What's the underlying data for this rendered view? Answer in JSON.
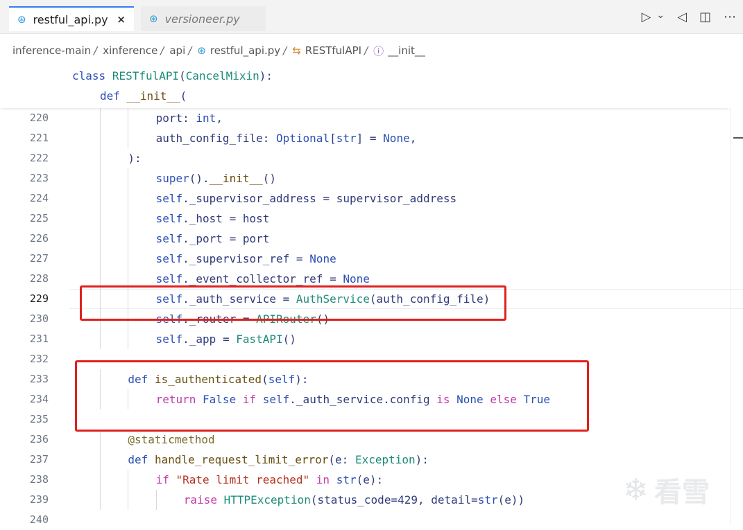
{
  "tabs": [
    {
      "label": "restful_api.py",
      "close": "×"
    },
    {
      "label": "versioneer.py"
    }
  ],
  "toolbar": {
    "run_icon": "play-icon",
    "run_glyph": "▷",
    "dropdown_glyph": "⌄",
    "broadcast_glyph": "◁",
    "split_glyph": "◫",
    "more_glyph": "⋯"
  },
  "breadcrumb": {
    "items": [
      "inference-main",
      "xinference",
      "api",
      "restful_api.py",
      "RESTfulAPI",
      "__init__"
    ],
    "separator": "/"
  },
  "sticky": {
    "line1": "class RESTfulAPI(CancelMixin):",
    "line2": "def __init__("
  },
  "lines": [
    {
      "num": "220",
      "text": "port: int,"
    },
    {
      "num": "221",
      "text": "auth_config_file: Optional[str] = None,"
    },
    {
      "num": "222",
      "text": "):"
    },
    {
      "num": "223",
      "text": "super().__init__()"
    },
    {
      "num": "224",
      "text": "self._supervisor_address = supervisor_address"
    },
    {
      "num": "225",
      "text": "self._host = host"
    },
    {
      "num": "226",
      "text": "self._port = port"
    },
    {
      "num": "227",
      "text": "self._supervisor_ref = None"
    },
    {
      "num": "228",
      "text": "self._event_collector_ref = None"
    },
    {
      "num": "229",
      "text": "self._auth_service = AuthService(auth_config_file)"
    },
    {
      "num": "230",
      "text": "self._router = APIRouter()"
    },
    {
      "num": "231",
      "text": "self._app = FastAPI()"
    },
    {
      "num": "232",
      "text": ""
    },
    {
      "num": "233",
      "text": "def is_authenticated(self):"
    },
    {
      "num": "234",
      "text": "return False if self._auth_service.config is None else True"
    },
    {
      "num": "235",
      "text": ""
    },
    {
      "num": "236",
      "text": "@staticmethod"
    },
    {
      "num": "237",
      "text": "def handle_request_limit_error(e: Exception):"
    },
    {
      "num": "238",
      "text": "if \"Rate limit reached\" in str(e):"
    },
    {
      "num": "239",
      "text": "raise HTTPException(status_code=429, detail=str(e))"
    },
    {
      "num": "240",
      "text": ""
    }
  ],
  "colors": {
    "highlight_box": "#e0201c",
    "active_tab_accent": "#2f80ed"
  },
  "watermark": {
    "text": "看雪"
  }
}
